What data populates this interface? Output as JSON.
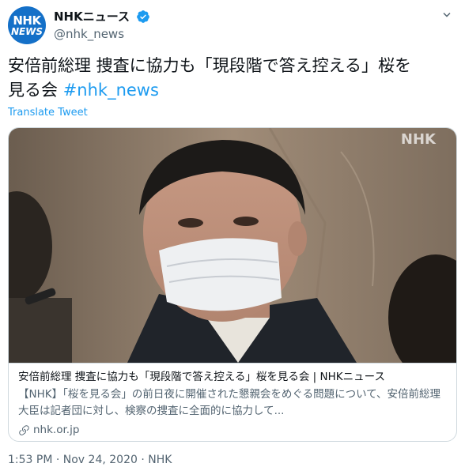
{
  "author": {
    "display_name": "NHKニュース",
    "handle": "@nhk_news",
    "avatar_text_top": "NHK",
    "avatar_text_bottom": "NEWS",
    "verified_icon": "verified-badge-icon"
  },
  "tweet": {
    "text_part1": "安倍前総理 捜査に協力も「現段階で答え控える」桜を",
    "text_part2": "見る会 ",
    "hashtag": "#nhk_news",
    "translate_label": "Translate Tweet"
  },
  "card": {
    "watermark": "NHK",
    "title": "安倍前総理 捜査に協力も「現段階で答え控える」桜を見る会 | NHKニュース",
    "description": "【NHK】「桜を見る会」の前日夜に開催された懇親会をめぐる問題について、安倍前総理大臣は記者団に対し、検察の捜査に全面的に協力して...",
    "domain": "nhk.or.jp"
  },
  "meta": {
    "timestamp": "1:53 PM · Nov 24, 2020 · NHK"
  },
  "colors": {
    "accent": "#1d9bf0",
    "avatar_bg": "#1470c8",
    "text": "#0f1419",
    "secondary": "#536471"
  }
}
